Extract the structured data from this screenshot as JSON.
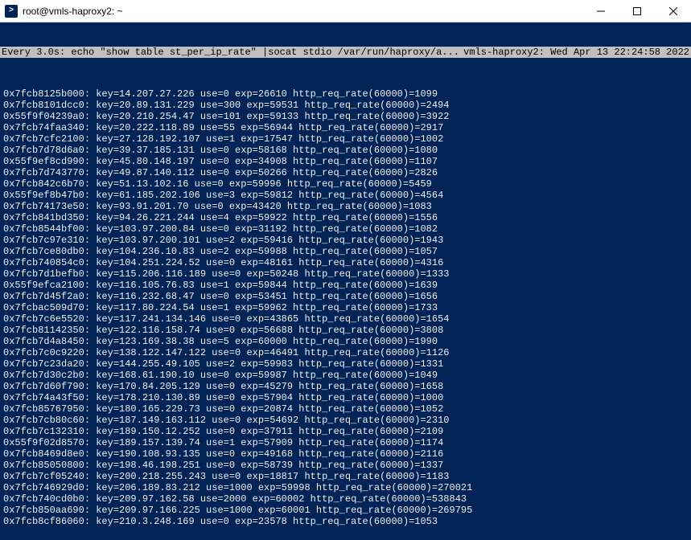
{
  "window": {
    "title": "root@vmls-haproxy2: ~"
  },
  "watch": {
    "left": "Every 3.0s: echo \"show table st_per_ip_rate\" |socat stdio /var/run/haproxy/a...",
    "right": "vmls-haproxy2: Wed Apr 13 22:24:58 2022"
  },
  "entries": [
    {
      "ptr": "0x7fcb8125b000",
      "key": "14.207.27.226",
      "use": "0",
      "exp": "26610",
      "rate": "1099"
    },
    {
      "ptr": "0x7fcb8101dcc0",
      "key": "20.89.131.229",
      "use": "300",
      "exp": "59531",
      "rate": "2494"
    },
    {
      "ptr": "0x55f9f04239a0",
      "key": "20.210.254.47",
      "use": "101",
      "exp": "59133",
      "rate": "3922"
    },
    {
      "ptr": "0x7fcb74faa340",
      "key": "20.222.118.89",
      "use": "55",
      "exp": "56944",
      "rate": "2917"
    },
    {
      "ptr": "0x7fcb7cfc2100",
      "key": "27.128.192.107",
      "use": "1",
      "exp": "17547",
      "rate": "1002"
    },
    {
      "ptr": "0x7fcb7d78d6a0",
      "key": "39.37.185.131",
      "use": "0",
      "exp": "58168",
      "rate": "1080"
    },
    {
      "ptr": "0x55f9ef8cd990",
      "key": "45.80.148.197",
      "use": "0",
      "exp": "34908",
      "rate": "1107"
    },
    {
      "ptr": "0x7fcb7d743770",
      "key": "49.87.140.112",
      "use": "0",
      "exp": "50266",
      "rate": "2826"
    },
    {
      "ptr": "0x7fcb842c6b70",
      "key": "51.13.102.16",
      "use": "0",
      "exp": "59996",
      "rate": "5459"
    },
    {
      "ptr": "0x55f9ef8b47b0",
      "key": "61.185.202.106",
      "use": "3",
      "exp": "59812",
      "rate": "4564"
    },
    {
      "ptr": "0x7fcb74173e50",
      "key": "93.91.201.70",
      "use": "0",
      "exp": "43420",
      "rate": "1083"
    },
    {
      "ptr": "0x7fcb841bd350",
      "key": "94.26.221.244",
      "use": "4",
      "exp": "59922",
      "rate": "1556"
    },
    {
      "ptr": "0x7fcb8544bf00",
      "key": "103.97.200.84",
      "use": "0",
      "exp": "31192",
      "rate": "1082"
    },
    {
      "ptr": "0x7fcb7c97e310",
      "key": "103.97.200.101",
      "use": "2",
      "exp": "59416",
      "rate": "1943"
    },
    {
      "ptr": "0x7fcb7ce80db0",
      "key": "104.236.10.83",
      "use": "2",
      "exp": "59988",
      "rate": "1057"
    },
    {
      "ptr": "0x7fcb740854c0",
      "key": "104.251.224.52",
      "use": "0",
      "exp": "48161",
      "rate": "4316"
    },
    {
      "ptr": "0x7fcb7d1befb0",
      "key": "115.206.116.189",
      "use": "0",
      "exp": "50248",
      "rate": "1333"
    },
    {
      "ptr": "0x55f9efca2100",
      "key": "116.105.76.83",
      "use": "1",
      "exp": "59844",
      "rate": "1639"
    },
    {
      "ptr": "0x7fcb7d45f2a0",
      "key": "116.232.68.47",
      "use": "0",
      "exp": "53451",
      "rate": "1656"
    },
    {
      "ptr": "0x7fcbac509d70",
      "key": "117.80.224.54",
      "use": "1",
      "exp": "59962",
      "rate": "1733"
    },
    {
      "ptr": "0x7fcb7c6e5520",
      "key": "117.241.134.146",
      "use": "0",
      "exp": "43865",
      "rate": "1654"
    },
    {
      "ptr": "0x7fcb81142350",
      "key": "122.116.158.74",
      "use": "0",
      "exp": "56688",
      "rate": "3808"
    },
    {
      "ptr": "0x7fcb7d4a8450",
      "key": "123.169.38.38",
      "use": "5",
      "exp": "60000",
      "rate": "1990"
    },
    {
      "ptr": "0x7fcb7c0c9220",
      "key": "138.122.147.122",
      "use": "0",
      "exp": "46491",
      "rate": "1126"
    },
    {
      "ptr": "0x7fcb7c23da20",
      "key": "144.255.49.105",
      "use": "2",
      "exp": "59983",
      "rate": "1331"
    },
    {
      "ptr": "0x7fcb7d30c2b0",
      "key": "168.61.190.10",
      "use": "0",
      "exp": "59987",
      "rate": "1049"
    },
    {
      "ptr": "0x7fcb7d60f790",
      "key": "170.84.205.129",
      "use": "0",
      "exp": "45279",
      "rate": "1658"
    },
    {
      "ptr": "0x7fcb74a43f50",
      "key": "178.210.130.89",
      "use": "0",
      "exp": "57904",
      "rate": "1000"
    },
    {
      "ptr": "0x7fcb85767950",
      "key": "180.165.229.73",
      "use": "0",
      "exp": "20874",
      "rate": "1052"
    },
    {
      "ptr": "0x7fcb7cb80c60",
      "key": "187.149.163.112",
      "use": "0",
      "exp": "54692",
      "rate": "2310"
    },
    {
      "ptr": "0x7fcb7c132310",
      "key": "189.150.12.252",
      "use": "0",
      "exp": "37911",
      "rate": "2109"
    },
    {
      "ptr": "0x55f9f02d8570",
      "key": "189.157.139.74",
      "use": "1",
      "exp": "57909",
      "rate": "1174"
    },
    {
      "ptr": "0x7fcb8469d8e0",
      "key": "190.108.93.135",
      "use": "0",
      "exp": "49168",
      "rate": "2116"
    },
    {
      "ptr": "0x7fcb85050800",
      "key": "198.46.198.251",
      "use": "0",
      "exp": "58739",
      "rate": "1337"
    },
    {
      "ptr": "0x7fcb7cf05240",
      "key": "200.218.255.243",
      "use": "0",
      "exp": "18817",
      "rate": "1183"
    },
    {
      "ptr": "0x7fcb746929d0",
      "key": "206.189.83.212",
      "use": "1000",
      "exp": "59998",
      "rate": "270021"
    },
    {
      "ptr": "0x7fcb740cd0b0",
      "key": "209.97.162.58",
      "use": "2000",
      "exp": "60002",
      "rate": "538843"
    },
    {
      "ptr": "0x7fcb850aa690",
      "key": "209.97.166.225",
      "use": "1000",
      "exp": "60001",
      "rate": "269795"
    },
    {
      "ptr": "0x7fcb8cf86060",
      "key": "210.3.248.169",
      "use": "0",
      "exp": "23578",
      "rate": "1053"
    }
  ]
}
